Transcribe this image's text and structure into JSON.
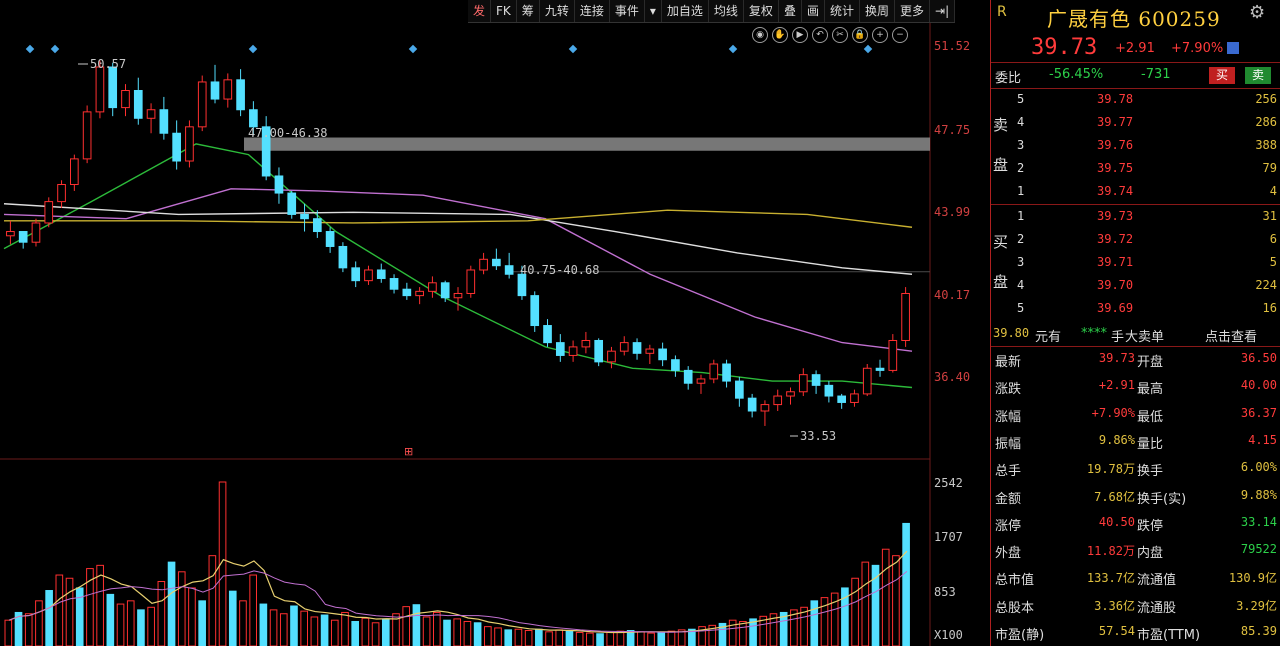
{
  "toolbar": {
    "items": [
      "发",
      "FK",
      "筹",
      "九转",
      "连接",
      "事件",
      "▾",
      "加自选",
      "均线",
      "复权",
      "叠",
      "画",
      "统计",
      "换周",
      "更多",
      "⇥|"
    ],
    "controls": [
      "eye-icon",
      "hand-icon",
      "play-icon",
      "undo-icon",
      "cut-icon",
      "lock-icon",
      "zoom-in-icon",
      "zoom-out-icon"
    ]
  },
  "chart": {
    "price_axis": [
      "51.52",
      "47.75",
      "43.99",
      "40.17",
      "36.40"
    ],
    "volume_axis": [
      "2542",
      "1707",
      "853",
      "X100"
    ],
    "annotations": {
      "high": "50.57",
      "low": "33.53",
      "gap1": "47.00-46.38",
      "gap2": "40.75-40.68"
    },
    "marker": "⊞"
  },
  "chart_data": {
    "type": "candlestick",
    "ylim": [
      32,
      52.5
    ],
    "ticks": [
      51.52,
      47.75,
      43.99,
      40.17,
      36.4
    ],
    "candles": [
      [
        42.4,
        43.1,
        42.0,
        42.6
      ],
      [
        42.6,
        42.6,
        41.8,
        42.1
      ],
      [
        42.1,
        43.2,
        41.9,
        43.0
      ],
      [
        43.0,
        44.2,
        42.8,
        44.0
      ],
      [
        44.0,
        45.0,
        43.7,
        44.8
      ],
      [
        44.8,
        46.2,
        44.5,
        46.0
      ],
      [
        46.0,
        48.5,
        45.8,
        48.2
      ],
      [
        48.2,
        50.6,
        47.9,
        50.3
      ],
      [
        50.3,
        50.5,
        48.0,
        48.4
      ],
      [
        48.4,
        49.5,
        48.0,
        49.2
      ],
      [
        49.2,
        49.8,
        47.6,
        47.9
      ],
      [
        47.9,
        48.6,
        47.2,
        48.3
      ],
      [
        48.3,
        48.9,
        46.9,
        47.2
      ],
      [
        47.2,
        47.8,
        45.5,
        45.9
      ],
      [
        45.9,
        47.8,
        45.6,
        47.5
      ],
      [
        47.5,
        49.9,
        47.3,
        49.6
      ],
      [
        49.6,
        50.4,
        48.6,
        48.8
      ],
      [
        48.8,
        50.0,
        48.4,
        49.7
      ],
      [
        49.7,
        50.2,
        48.0,
        48.3
      ],
      [
        48.3,
        48.7,
        47.1,
        47.5
      ],
      [
        47.5,
        48.0,
        45.0,
        45.2
      ],
      [
        45.2,
        45.6,
        43.9,
        44.4
      ],
      [
        44.4,
        44.5,
        43.2,
        43.4
      ],
      [
        43.4,
        43.9,
        42.6,
        43.2
      ],
      [
        43.2,
        43.6,
        42.3,
        42.6
      ],
      [
        42.6,
        42.8,
        41.6,
        41.9
      ],
      [
        41.9,
        42.1,
        40.7,
        40.9
      ],
      [
        40.9,
        41.2,
        40.0,
        40.3
      ],
      [
        40.3,
        41.0,
        40.1,
        40.8
      ],
      [
        40.8,
        41.1,
        40.2,
        40.4
      ],
      [
        40.4,
        40.6,
        39.7,
        39.9
      ],
      [
        39.9,
        40.2,
        39.4,
        39.6
      ],
      [
        39.6,
        40.0,
        39.2,
        39.8
      ],
      [
        39.8,
        40.5,
        39.5,
        40.2
      ],
      [
        40.2,
        40.3,
        39.3,
        39.5
      ],
      [
        39.5,
        40.0,
        38.9,
        39.7
      ],
      [
        39.7,
        41.0,
        39.5,
        40.8
      ],
      [
        40.8,
        41.6,
        40.6,
        41.3
      ],
      [
        41.3,
        41.8,
        40.8,
        41.0
      ],
      [
        41.0,
        41.6,
        40.4,
        40.6
      ],
      [
        40.6,
        41.0,
        39.4,
        39.6
      ],
      [
        39.6,
        39.8,
        37.9,
        38.2
      ],
      [
        38.2,
        38.5,
        37.2,
        37.4
      ],
      [
        37.4,
        37.8,
        36.5,
        36.8
      ],
      [
        36.8,
        37.5,
        36.5,
        37.2
      ],
      [
        37.2,
        37.9,
        36.9,
        37.5
      ],
      [
        37.5,
        37.6,
        36.3,
        36.5
      ],
      [
        36.5,
        37.2,
        36.2,
        37.0
      ],
      [
        37.0,
        37.7,
        36.8,
        37.4
      ],
      [
        37.4,
        37.6,
        36.6,
        36.9
      ],
      [
        36.9,
        37.3,
        36.4,
        37.1
      ],
      [
        37.1,
        37.4,
        36.3,
        36.6
      ],
      [
        36.6,
        36.8,
        35.8,
        36.1
      ],
      [
        36.1,
        36.3,
        35.2,
        35.5
      ],
      [
        35.5,
        35.9,
        35.0,
        35.7
      ],
      [
        35.7,
        36.6,
        35.5,
        36.4
      ],
      [
        36.4,
        36.6,
        35.3,
        35.6
      ],
      [
        35.6,
        35.8,
        34.4,
        34.8
      ],
      [
        34.8,
        35.0,
        33.9,
        34.2
      ],
      [
        34.2,
        34.7,
        33.5,
        34.5
      ],
      [
        34.5,
        35.2,
        34.2,
        34.9
      ],
      [
        34.9,
        35.3,
        34.5,
        35.1
      ],
      [
        35.1,
        36.2,
        34.9,
        35.9
      ],
      [
        35.9,
        36.1,
        35.0,
        35.4
      ],
      [
        35.4,
        35.6,
        34.6,
        34.9
      ],
      [
        34.9,
        35.0,
        34.3,
        34.6
      ],
      [
        34.6,
        35.2,
        34.4,
        35.0
      ],
      [
        35.0,
        36.4,
        34.9,
        36.2
      ],
      [
        36.2,
        36.6,
        35.8,
        36.1
      ],
      [
        36.1,
        37.8,
        36.0,
        37.5
      ],
      [
        37.5,
        40.0,
        37.2,
        39.7
      ]
    ],
    "ma": [
      {
        "name": "MA-green",
        "color": "#2cba3a",
        "values": [
          [
            0,
            41.8
          ],
          [
            10,
            44.0
          ],
          [
            22,
            46.7
          ],
          [
            28,
            46.2
          ],
          [
            38,
            42.6
          ],
          [
            50,
            39.6
          ],
          [
            62,
            37.2
          ],
          [
            72,
            36.2
          ],
          [
            80,
            36.0
          ],
          [
            88,
            35.6
          ],
          [
            96,
            35.6
          ],
          [
            104,
            35.3
          ]
        ]
      },
      {
        "name": "MA-purple",
        "color": "#c070d0",
        "values": [
          [
            0,
            43.4
          ],
          [
            14,
            43.2
          ],
          [
            26,
            44.6
          ],
          [
            36,
            44.5
          ],
          [
            48,
            44.3
          ],
          [
            62,
            43.2
          ],
          [
            74,
            40.6
          ],
          [
            86,
            38.6
          ],
          [
            96,
            37.4
          ],
          [
            104,
            37.0
          ]
        ]
      },
      {
        "name": "MA-white",
        "color": "#dedede",
        "values": [
          [
            0,
            43.9
          ],
          [
            20,
            43.4
          ],
          [
            40,
            43.5
          ],
          [
            58,
            43.4
          ],
          [
            70,
            42.6
          ],
          [
            84,
            41.6
          ],
          [
            96,
            40.9
          ],
          [
            104,
            40.6
          ]
        ]
      },
      {
        "name": "MA-yellow",
        "color": "#c8b030",
        "values": [
          [
            0,
            43.1
          ],
          [
            20,
            43.1
          ],
          [
            40,
            43.0
          ],
          [
            60,
            43.1
          ],
          [
            76,
            43.6
          ],
          [
            92,
            43.4
          ],
          [
            104,
            42.8
          ]
        ]
      }
    ],
    "volumes": [
      400,
      520,
      500,
      700,
      860,
      1100,
      1050,
      900,
      1200,
      1250,
      800,
      650,
      700,
      560,
      600,
      1000,
      1300,
      1150,
      900,
      700,
      1400,
      2542,
      850,
      700,
      1100,
      650,
      560,
      500,
      620,
      540,
      450,
      480,
      400,
      520,
      380,
      430,
      360,
      420,
      500,
      610,
      640,
      450,
      520,
      400,
      420,
      380,
      360,
      300,
      280,
      250,
      260,
      240,
      260,
      220,
      250,
      230,
      210,
      200,
      190,
      210,
      230,
      240,
      220,
      200,
      210,
      230,
      250,
      260,
      300,
      320,
      350,
      400,
      380,
      420,
      460,
      500,
      520,
      560,
      600,
      700,
      750,
      820,
      900,
      1050,
      1300,
      1250,
      1500,
      1400,
      1900
    ]
  },
  "panel": {
    "header": {
      "tag": "R",
      "name": "广晟有色 600259"
    },
    "price": {
      "last": "39.73",
      "change": "+2.91",
      "pct": "+7.90%"
    },
    "webi": {
      "label": "委比",
      "ratio": "-56.45%",
      "diff": "-731",
      "buy": "买",
      "sell": "卖"
    },
    "sell_side": "卖盘",
    "buy_side": "买盘",
    "asks": [
      {
        "lvl": "5",
        "price": "39.78",
        "vol": "256"
      },
      {
        "lvl": "4",
        "price": "39.77",
        "vol": "286"
      },
      {
        "lvl": "3",
        "price": "39.76",
        "vol": "388"
      },
      {
        "lvl": "2",
        "price": "39.75",
        "vol": "79"
      },
      {
        "lvl": "1",
        "price": "39.74",
        "vol": "4"
      }
    ],
    "bids": [
      {
        "lvl": "1",
        "price": "39.73",
        "vol": "31"
      },
      {
        "lvl": "2",
        "price": "39.72",
        "vol": "6"
      },
      {
        "lvl": "3",
        "price": "39.71",
        "vol": "5"
      },
      {
        "lvl": "4",
        "price": "39.70",
        "vol": "224"
      },
      {
        "lvl": "5",
        "price": "39.69",
        "vol": "16"
      }
    ],
    "bigorder": {
      "price": "39.80",
      "unit": "元有",
      "stars": "****",
      "hand": "手",
      "type": "大卖单",
      "link": "点击查看"
    },
    "quote": [
      {
        "k1": "最新",
        "v1": "39.73",
        "c1": "#ff3b3b",
        "k2": "开盘",
        "v2": "36.50",
        "c2": "#ff3b3b"
      },
      {
        "k1": "涨跌",
        "v1": "+2.91",
        "c1": "#ff3b3b",
        "k2": "最高",
        "v2": "40.00",
        "c2": "#ff3b3b"
      },
      {
        "k1": "涨幅",
        "v1": "+7.90%",
        "c1": "#ff3b3b",
        "k2": "最低",
        "v2": "36.37",
        "c2": "#ff3b3b"
      },
      {
        "k1": "振幅",
        "v1": "9.86%",
        "c1": "#e0c040",
        "k2": "量比",
        "v2": "4.15",
        "c2": "#ff3b3b"
      },
      {
        "k1": "总手",
        "v1": "19.78万",
        "c1": "#e0c040",
        "k2": "换手",
        "v2": "6.00%",
        "c2": "#e0c040"
      },
      {
        "k1": "金额",
        "v1": "7.68亿",
        "c1": "#e0c040",
        "k2": "换手(实)",
        "v2": "9.88%",
        "c2": "#e0c040"
      },
      {
        "k1": "涨停",
        "v1": "40.50",
        "c1": "#ff3b3b",
        "k2": "跌停",
        "v2": "33.14",
        "c2": "#2cd04a"
      },
      {
        "k1": "外盘",
        "v1": "11.82万",
        "c1": "#ff3b3b",
        "k2": "内盘",
        "v2": "79522",
        "c2": "#2cd04a"
      },
      {
        "k1": "总市值",
        "v1": "133.7亿",
        "c1": "#e0c040",
        "k2": "流通值",
        "v2": "130.9亿",
        "c2": "#e0c040"
      },
      {
        "k1": "总股本",
        "v1": "3.36亿",
        "c1": "#e0c040",
        "k2": "流通股",
        "v2": "3.29亿",
        "c2": "#e0c040"
      },
      {
        "k1": "市盈(静)",
        "v1": "57.54",
        "c1": "#e0c040",
        "k2": "市盈(TTM)",
        "v2": "85.39",
        "c2": "#e0c040"
      }
    ]
  }
}
